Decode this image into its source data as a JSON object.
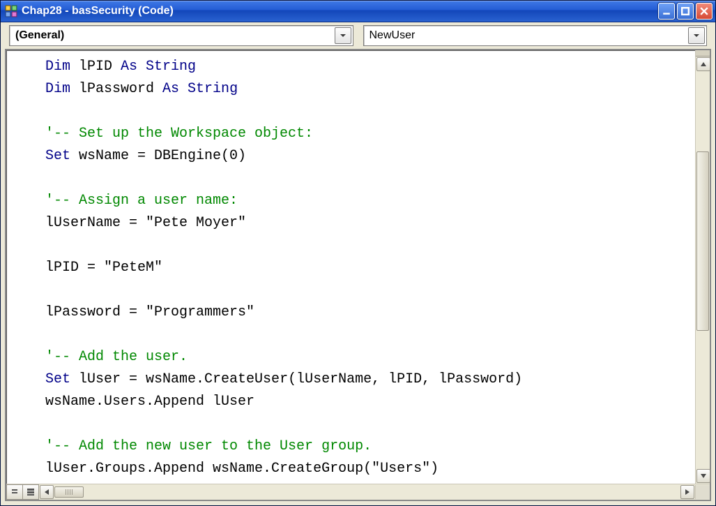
{
  "window": {
    "title": "Chap28 - basSecurity (Code)"
  },
  "dropdowns": {
    "object": "(General)",
    "procedure": "NewUser"
  },
  "code_lines": [
    {
      "tokens": [
        {
          "t": "Dim ",
          "c": "kw"
        },
        {
          "t": "lPID ",
          "c": "tx"
        },
        {
          "t": "As String",
          "c": "kw"
        }
      ]
    },
    {
      "tokens": [
        {
          "t": "Dim ",
          "c": "kw"
        },
        {
          "t": "lPassword ",
          "c": "tx"
        },
        {
          "t": "As String",
          "c": "kw"
        }
      ]
    },
    {
      "tokens": [
        {
          "t": "",
          "c": "tx"
        }
      ]
    },
    {
      "tokens": [
        {
          "t": "'-- Set up the Workspace object:",
          "c": "cm"
        }
      ]
    },
    {
      "tokens": [
        {
          "t": "Set ",
          "c": "kw"
        },
        {
          "t": "wsName = DBEngine(0)",
          "c": "tx"
        }
      ]
    },
    {
      "tokens": [
        {
          "t": "",
          "c": "tx"
        }
      ]
    },
    {
      "tokens": [
        {
          "t": "'-- Assign a user name:",
          "c": "cm"
        }
      ]
    },
    {
      "tokens": [
        {
          "t": "lUserName = \"Pete Moyer\"",
          "c": "tx"
        }
      ]
    },
    {
      "tokens": [
        {
          "t": "",
          "c": "tx"
        }
      ]
    },
    {
      "tokens": [
        {
          "t": "lPID = \"PeteM\"",
          "c": "tx"
        }
      ]
    },
    {
      "tokens": [
        {
          "t": "",
          "c": "tx"
        }
      ]
    },
    {
      "tokens": [
        {
          "t": "lPassword = \"Programmers\"",
          "c": "tx"
        }
      ]
    },
    {
      "tokens": [
        {
          "t": "",
          "c": "tx"
        }
      ]
    },
    {
      "tokens": [
        {
          "t": "'-- Add the user.",
          "c": "cm"
        }
      ]
    },
    {
      "tokens": [
        {
          "t": "Set ",
          "c": "kw"
        },
        {
          "t": "lUser = wsName.CreateUser(lUserName, lPID, lPassword)",
          "c": "tx"
        }
      ]
    },
    {
      "tokens": [
        {
          "t": "wsName.Users.Append lUser",
          "c": "tx"
        }
      ]
    },
    {
      "tokens": [
        {
          "t": "",
          "c": "tx"
        }
      ]
    },
    {
      "tokens": [
        {
          "t": "'-- Add the new user to the User group.",
          "c": "cm"
        }
      ]
    },
    {
      "tokens": [
        {
          "t": "lUser.Groups.Append wsName.CreateGroup(\"Users\")",
          "c": "tx"
        }
      ]
    }
  ]
}
